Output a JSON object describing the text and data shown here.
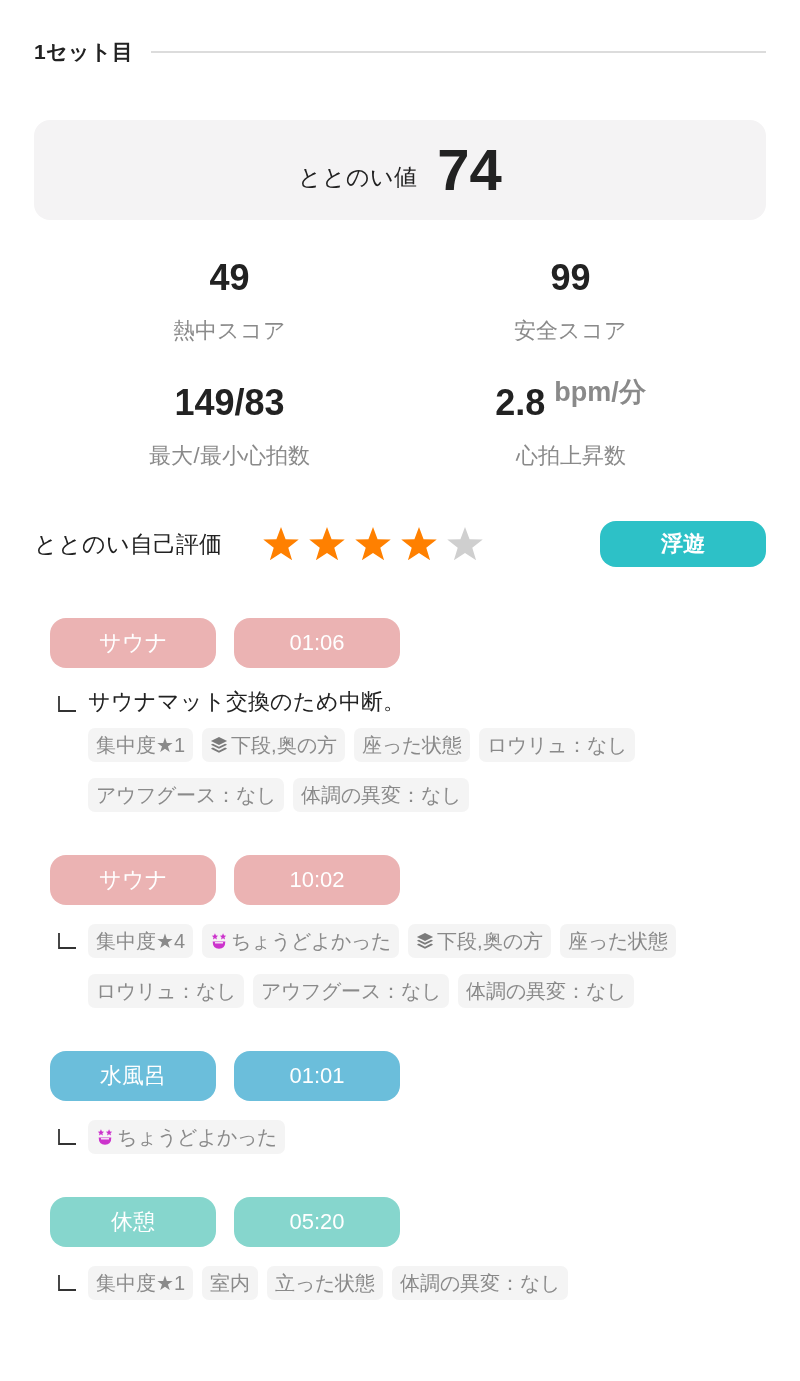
{
  "set": {
    "title": "1セット目"
  },
  "score": {
    "label": "ととのい値",
    "value": "74"
  },
  "stats": [
    {
      "value": "49",
      "label": "熱中スコア"
    },
    {
      "value": "99",
      "label": "安全スコア"
    },
    {
      "value": "149/83",
      "label": "最大/最小心拍数"
    },
    {
      "value": "2.8",
      "unit": "bpm/分",
      "label": "心拍上昇数"
    }
  ],
  "rating": {
    "label": "ととのい自己評価",
    "stars": 4,
    "badge": "浮遊"
  },
  "steps": [
    {
      "type": "サウナ",
      "time": "01:06",
      "color": "#ebb3b3",
      "note": "サウナマット交換のため中断。",
      "tags": [
        {
          "kind": "plain",
          "text": "集中度★1"
        },
        {
          "kind": "position",
          "text": "下段,奥の方"
        },
        {
          "kind": "plain",
          "text": "座った状態"
        },
        {
          "kind": "plain",
          "text": "ロウリュ：なし"
        },
        {
          "kind": "plain",
          "text": "アウフグース：なし"
        },
        {
          "kind": "plain",
          "text": "体調の異変：なし"
        }
      ]
    },
    {
      "type": "サウナ",
      "time": "10:02",
      "color": "#ebb3b3",
      "tags": [
        {
          "kind": "plain",
          "text": "集中度★4"
        },
        {
          "kind": "feeling",
          "text": "ちょうどよかった"
        },
        {
          "kind": "position",
          "text": "下段,奥の方"
        },
        {
          "kind": "plain",
          "text": "座った状態"
        },
        {
          "kind": "plain",
          "text": "ロウリュ：なし"
        },
        {
          "kind": "plain",
          "text": "アウフグース：なし"
        },
        {
          "kind": "plain",
          "text": "体調の異変：なし"
        }
      ]
    },
    {
      "type": "水風呂",
      "time": "01:01",
      "color": "#6bbedb",
      "tags": [
        {
          "kind": "feeling",
          "text": "ちょうどよかった"
        }
      ]
    },
    {
      "type": "休憩",
      "time": "05:20",
      "color": "#86d6cd",
      "tags": [
        {
          "kind": "plain",
          "text": "集中度★1"
        },
        {
          "kind": "plain",
          "text": "室内"
        },
        {
          "kind": "plain",
          "text": "立った状態"
        },
        {
          "kind": "plain",
          "text": "体調の異変：なし"
        }
      ]
    }
  ]
}
